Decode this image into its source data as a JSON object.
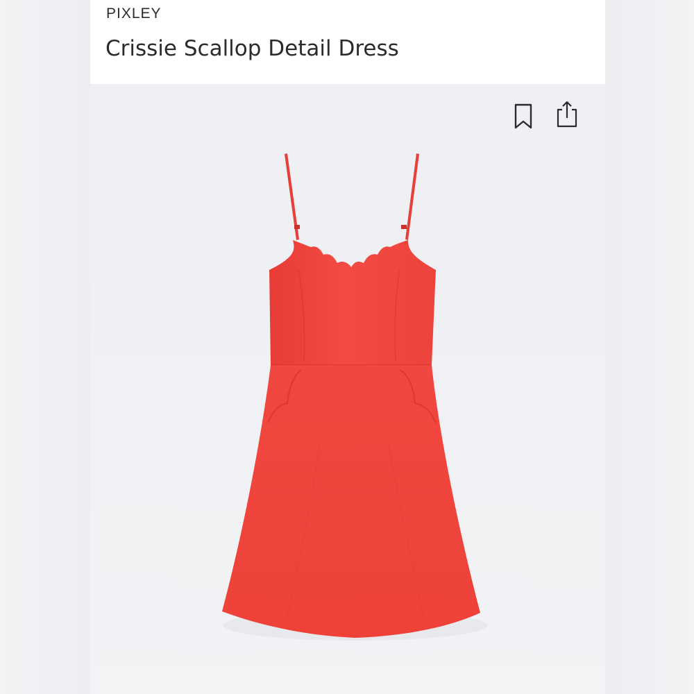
{
  "product": {
    "brand": "PIXLEY",
    "name": "Crissie Scallop Detail Dress"
  },
  "actions": {
    "bookmark_icon": "bookmark-icon",
    "share_icon": "share-icon"
  },
  "image": {
    "subject": "red-sleeveless-dress",
    "color": "#f0473f"
  },
  "colors": {
    "text": "#2b2b2e",
    "image_background": "#eef0f3",
    "product_red": "#f0473f"
  }
}
